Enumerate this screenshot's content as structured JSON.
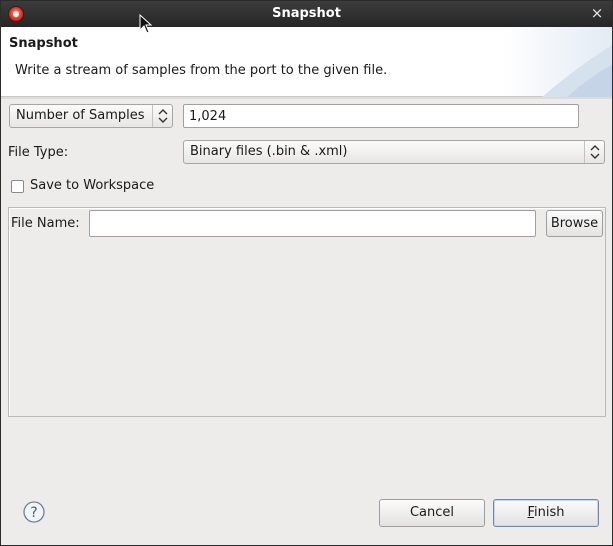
{
  "window": {
    "title": "Snapshot",
    "close_glyph": "×"
  },
  "header": {
    "title": "Snapshot",
    "description": "Write a stream of samples from the port to the given file."
  },
  "samples": {
    "mode_selected": "Number of Samples",
    "count_value": "1,024"
  },
  "file_type": {
    "label": "File Type:",
    "selected": "Binary files (.bin & .xml)"
  },
  "workspace": {
    "label": "Save to Workspace",
    "checked": false
  },
  "file_name": {
    "label": "File Name:",
    "value": "",
    "browse_label": "Browse"
  },
  "footer": {
    "cancel_label": "Cancel",
    "finish_label": "Finish",
    "finish_mnemonic": "F",
    "finish_rest": "inish"
  },
  "icons": {
    "app": "app-logo-icon",
    "help": "help-icon",
    "arrows": "up-down-arrows-icon",
    "pointer": "mouse-pointer-icon"
  }
}
